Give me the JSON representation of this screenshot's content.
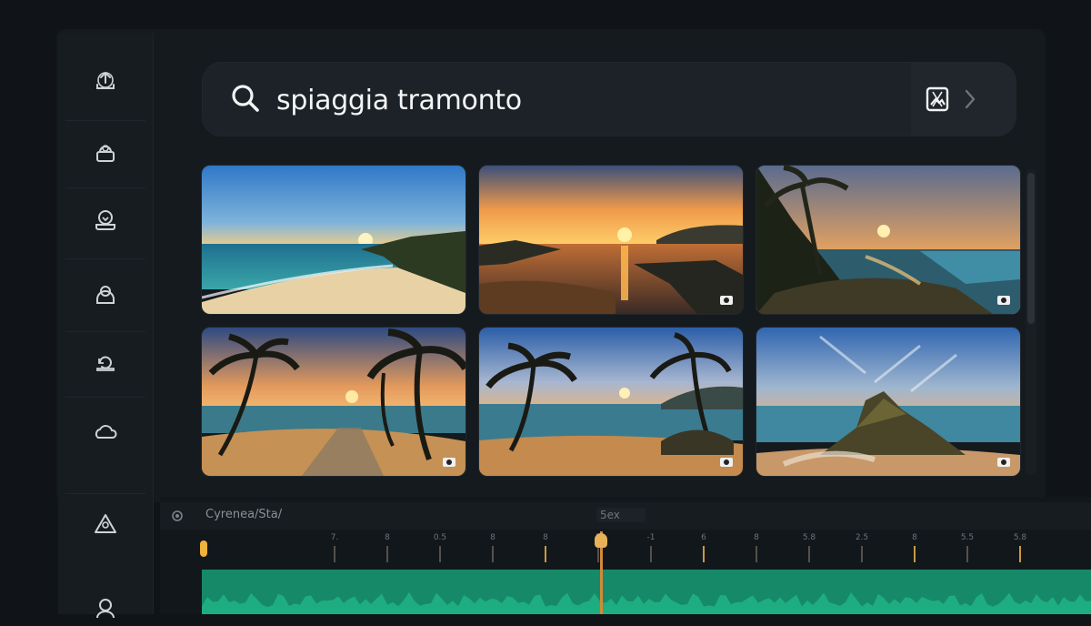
{
  "search": {
    "query": "spiaggia tramonto",
    "placeholder": ""
  },
  "sidebar": {
    "items": [
      {
        "icon": "upload-icon"
      },
      {
        "icon": "media-library-icon"
      },
      {
        "icon": "download-icon"
      },
      {
        "icon": "person-icon"
      },
      {
        "icon": "refresh-icon"
      },
      {
        "icon": "cloud-icon"
      },
      {
        "icon": "triangle-warning-icon"
      },
      {
        "icon": "user-icon"
      }
    ]
  },
  "results": [
    {
      "name": "beach-daylight-sunset",
      "badge": false
    },
    {
      "name": "orange-sunset-bay",
      "badge": true
    },
    {
      "name": "palm-lagoon-sunset",
      "badge": true
    },
    {
      "name": "palms-road-sunset",
      "badge": true
    },
    {
      "name": "palms-blue-sky-sunset",
      "badge": true
    },
    {
      "name": "rock-island-sky",
      "badge": true
    }
  ],
  "timeline": {
    "track_label": "Cyrenea/Sta/",
    "center_label": "5ex",
    "ruler_ticks": [
      "7.",
      "8",
      "0.5",
      "8",
      "8",
      "5",
      "-1",
      "6",
      "8",
      "5.8",
      "2.5",
      "8",
      "5.5",
      "5.8"
    ]
  },
  "colors": {
    "background": "#101418",
    "panel": "#151a1f",
    "accent_audio": "#168a68",
    "playhead": "#d08a3a"
  }
}
